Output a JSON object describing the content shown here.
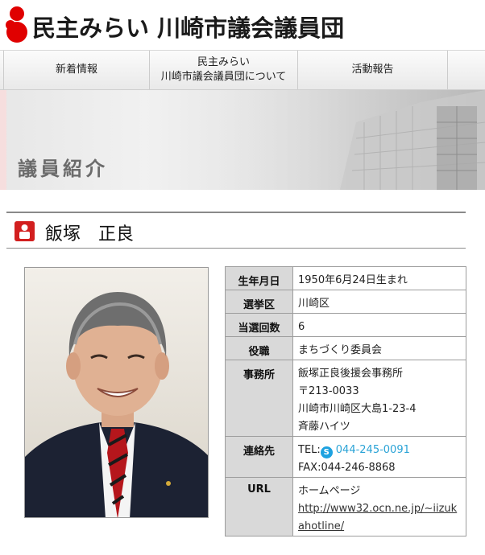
{
  "header": {
    "site_title": "民主みらい 川崎市議会議員団"
  },
  "nav": {
    "items": [
      {
        "line1": "新着情報",
        "line2": ""
      },
      {
        "line1": "民主みらい",
        "line2": "川崎市議会議員団について"
      },
      {
        "line1": "活動報告",
        "line2": ""
      }
    ]
  },
  "banner": {
    "title": "議員紹介"
  },
  "member": {
    "name": "飯塚　正良"
  },
  "profile": {
    "rows": [
      {
        "label": "生年月日",
        "value": "1950年6月24日生まれ"
      },
      {
        "label": "選挙区",
        "value": "川崎区"
      },
      {
        "label": "当選回数",
        "value": "6"
      },
      {
        "label": "役職",
        "value": "まちづくり委員会"
      },
      {
        "label": "事務所",
        "lines": [
          "飯塚正良後援会事務所",
          "〒213-0033",
          "川崎市川崎区大島1-23-4",
          "斉藤ハイツ"
        ]
      },
      {
        "label": "連絡先",
        "tel_label": "TEL:",
        "tel": "044-245-0091",
        "fax": "FAX:044-246-8868"
      },
      {
        "label": "URL",
        "homepage_label": "ホームページ",
        "url": "http://www32.ocn.ne.jp/~iizukahotline/"
      }
    ]
  },
  "colors": {
    "accent_red": "#d21f1f",
    "link_blue": "#2aa3d6",
    "table_header_bg": "#d9d9d9"
  },
  "icons": {
    "logo": "red-circle-logo-icon",
    "person": "person-icon",
    "skype": "skype-icon"
  }
}
